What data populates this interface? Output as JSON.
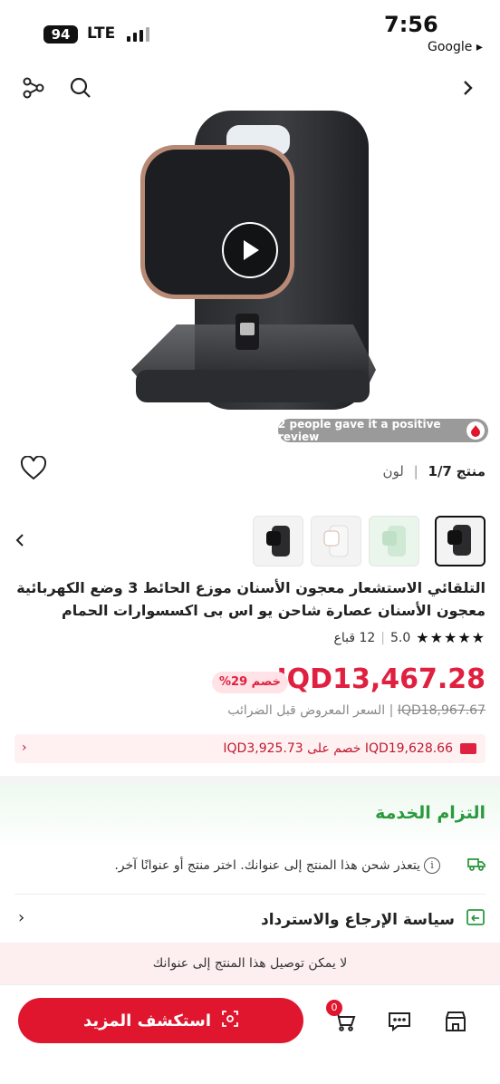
{
  "status_bar": {
    "battery": "94",
    "network": "LTE",
    "time": "7:56",
    "back_app": "Google ▸"
  },
  "product": {
    "review_pill": "2 people gave it a positive review",
    "variant_label": "منتج",
    "variant_count": "1/7",
    "color_label": "لون",
    "title": "التلقائي الاستشعار معجون الأسنان موزع الحائط 3 وضع الكهربائية معجون الأسنان عصارة شاحن يو اس بى اكسسوارات الحمام",
    "rating_value": "5.0",
    "sold_count": "12 قباع",
    "price": "IQD13,467.28",
    "discount_badge": "خصم 29%",
    "original_price": "IQD18,967.67",
    "original_price_note": "| السعر المعروض قبل الضرائب",
    "coupon_text": "IQD19,628.66 خصم على IQD3,925.73"
  },
  "service": {
    "title": "التزام الخدمة",
    "shipping_text": "يتعذر شحن هذا المنتج إلى عنوانك. اختر منتج أو عنوانًا آخر.",
    "return_policy": "سياسة الإرجاع والاسترداد",
    "notice": "لا يمكن توصيل هذا المنتج إلى عنوانك"
  },
  "bottom_bar": {
    "cta_label": "استكشف المزيد",
    "cart_count": "0"
  },
  "colors": {
    "accent": "#e0162f",
    "service_green": "#2b9a3f"
  }
}
